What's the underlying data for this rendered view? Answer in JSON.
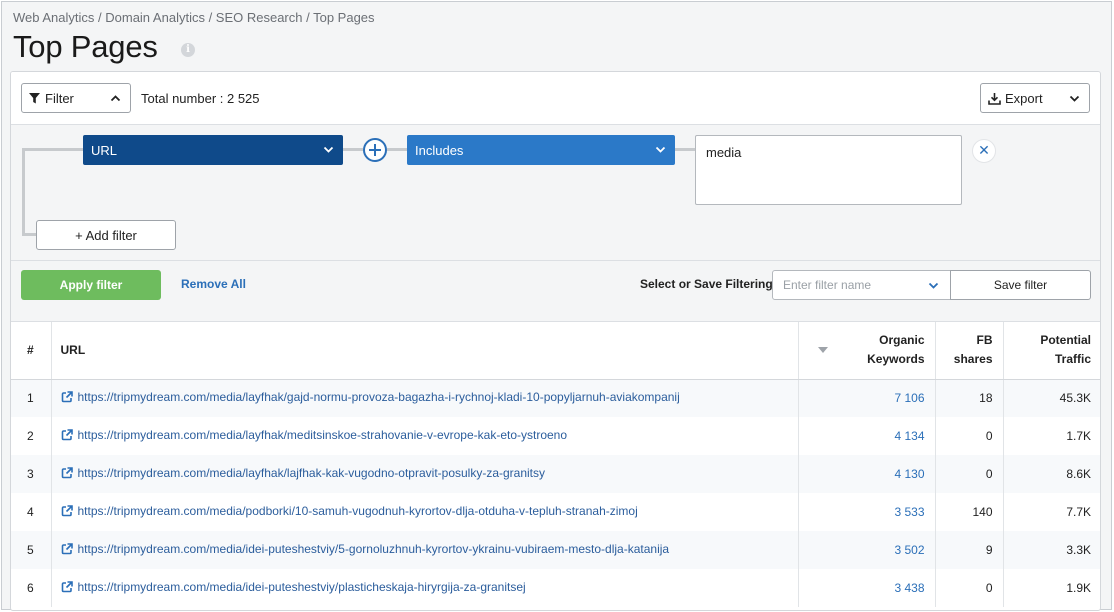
{
  "breadcrumb": "Web Analytics / Domain Analytics / SEO Research / Top Pages",
  "page_title": "Top Pages",
  "info_icon": "i",
  "toolbar": {
    "filter_label": "Filter",
    "total_label": "Total number : 2 525",
    "export_label": "Export"
  },
  "filter": {
    "field": "URL",
    "operator": "Includes",
    "value": "media",
    "clear_symbol": "✕",
    "add_filter_label": "+ Add filter"
  },
  "actions": {
    "apply_label": "Apply filter",
    "remove_all_label": "Remove All",
    "select_save_label": "Select or Save Filtering:",
    "filter_name_placeholder": "Enter filter name",
    "save_filter_label": "Save filter"
  },
  "table": {
    "headers": {
      "num": "#",
      "url": "URL",
      "organic_line1": "Organic",
      "organic_line2": "Keywords",
      "fb_line1": "FB",
      "fb_line2": "shares",
      "traffic_line1": "Potential",
      "traffic_line2": "Traffic"
    },
    "rows": [
      {
        "num": "1",
        "url": "https://tripmydream.com/media/layfhak/gajd-normu-provoza-bagazha-i-rychnoj-kladi-10-popyljarnuh-aviakompanij",
        "keywords": "7 106",
        "fb": "18",
        "traffic": "45.3K"
      },
      {
        "num": "2",
        "url": "https://tripmydream.com/media/layfhak/meditsinskoe-strahovanie-v-evrope-kak-eto-ystroeno",
        "keywords": "4 134",
        "fb": "0",
        "traffic": "1.7K"
      },
      {
        "num": "3",
        "url": "https://tripmydream.com/media/layfhak/lajfhak-kak-vugodno-otpravit-posulky-za-granitsy",
        "keywords": "4 130",
        "fb": "0",
        "traffic": "8.6K"
      },
      {
        "num": "4",
        "url": "https://tripmydream.com/media/podborki/10-samuh-vugodnuh-kyrortov-dlja-otduha-v-tepluh-stranah-zimoj",
        "keywords": "3 533",
        "fb": "140",
        "traffic": "7.7K"
      },
      {
        "num": "5",
        "url": "https://tripmydream.com/media/idei-puteshestviy/5-gornoluzhnuh-kyrortov-ykrainu-vubiraem-mesto-dlja-katanija",
        "keywords": "3 502",
        "fb": "9",
        "traffic": "3.3K"
      },
      {
        "num": "6",
        "url": "https://tripmydream.com/media/idei-puteshestviy/plasticheskaja-hiryrgija-za-granitsej",
        "keywords": "3 438",
        "fb": "0",
        "traffic": "1.9K"
      }
    ]
  }
}
